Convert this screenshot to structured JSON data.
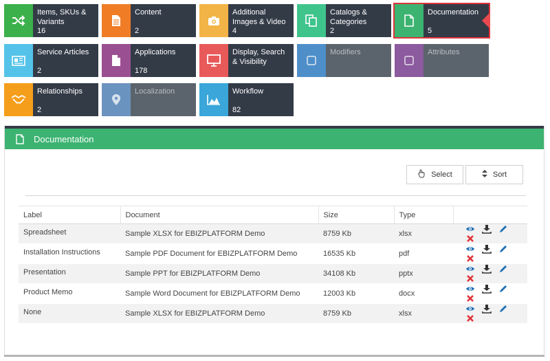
{
  "tiles": [
    {
      "label": "Items, SKUs & Variants",
      "count": "16",
      "color": "#3cb04b",
      "icon": "shuffle-icon"
    },
    {
      "label": "Content",
      "count": "2",
      "color": "#f07d26",
      "icon": "file-icon"
    },
    {
      "label": "Additional Images & Video",
      "count": "4",
      "color": "#f2b446",
      "icon": "camera-icon"
    },
    {
      "label": "Catalogs & Categories",
      "count": "2",
      "color": "#3fc48c",
      "icon": "copy-icon"
    },
    {
      "label": "Documentation",
      "count": "5",
      "color": "#3cb371",
      "icon": "document-icon"
    },
    {
      "label": "Service Articles",
      "count": "2",
      "color": "#55c3e9",
      "icon": "newspaper-icon"
    },
    {
      "label": "Applications",
      "count": "178",
      "color": "#9a4f93",
      "icon": "file-icon"
    },
    {
      "label": "Display, Search & Visibility",
      "count": "",
      "color": "#e85a5a",
      "icon": "monitor-icon"
    },
    {
      "label": "Modifiers",
      "count": "",
      "color": "#4e8fca",
      "icon": "square-icon"
    },
    {
      "label": "Attributes",
      "count": "",
      "color": "#8c5a9e",
      "icon": "square-icon"
    },
    {
      "label": "Relationships",
      "count": "2",
      "color": "#f59e1b",
      "icon": "handshake-icon"
    },
    {
      "label": "Localization",
      "count": "",
      "color": "#6b93bf",
      "icon": "map-marker-icon"
    },
    {
      "label": "Workflow",
      "count": "82",
      "color": "#3aa6d9",
      "icon": "area-chart-icon"
    }
  ],
  "panel": {
    "title": "Documentation",
    "select_label": "Select",
    "sort_label": "Sort"
  },
  "table": {
    "headers": [
      "Label",
      "Document",
      "Size",
      "Type",
      ""
    ],
    "rows": [
      {
        "label": "Spreadsheet",
        "document": "Sample XLSX for EBIZPLATFORM Demo",
        "size": "8759  Kb",
        "type": "xlsx"
      },
      {
        "label": "Installation Instructions",
        "document": "Sample PDF Document for EBIZPLATFORM Demo",
        "size": "16535  Kb",
        "type": "pdf"
      },
      {
        "label": "Presentation",
        "document": "Sample PPT for EBIZPLATFORM Demo",
        "size": "34108  Kb",
        "type": "pptx"
      },
      {
        "label": "Product Memo",
        "document": "Sample Word Document for EBIZPLATFORM Demo",
        "size": "12003  Kb",
        "type": "docx"
      },
      {
        "label": "None",
        "document": "Sample XLSX for EBIZPLATFORM Demo",
        "size": "8759  Kb",
        "type": "xlsx"
      }
    ]
  },
  "colors": {
    "accent": "#3cb371",
    "dark_tile": "#333b47",
    "action_blue": "#1f6fb5",
    "delete_red": "#e0333b"
  }
}
